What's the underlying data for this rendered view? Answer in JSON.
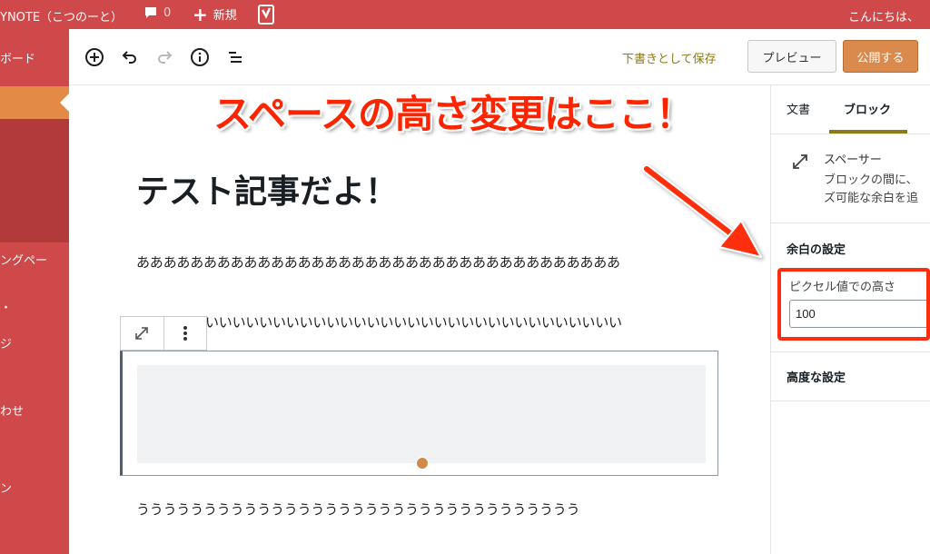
{
  "adminbar": {
    "site_title": "YNOTE（こつのーと）",
    "comment_count": "0",
    "new_label": "新規",
    "greeting": "こんにちは、"
  },
  "sidebar": {
    "items": [
      {
        "label": "ボード"
      },
      {
        "label": "ングペー"
      },
      {
        "label": "ジ"
      },
      {
        "label": "わせ"
      },
      {
        "label": "ン"
      }
    ]
  },
  "toolbar": {
    "save_draft": "下書きとして保存",
    "preview": "プレビュー",
    "publish": "公開する"
  },
  "annotation": {
    "text": "スペースの高さ変更はここ！",
    "color": "#ff2400"
  },
  "editor": {
    "post_title": "テスト記事だよ！",
    "para_a": "ああああああああああああああああああああああああああああああああああああ",
    "para_i": "いいいいいいいいいいいいいいいいいいいいいいいいいいいいいいい",
    "para_u": "ううううううううううううううううううううううううううううううううう"
  },
  "settings": {
    "tab_document": "文書",
    "tab_block": "ブロック",
    "block_name": "スペーサー",
    "block_description": "ブロックの間に、\nズ可能な余白を追",
    "spacing_panel_title": "余白の設定",
    "height_label": "ピクセル値での高さ",
    "height_value": "100",
    "advanced_title": "高度な設定"
  },
  "colors": {
    "adminbar": "#d0494a",
    "sidebar_active": "#e38a47",
    "publish": "#d98a4c",
    "accent": "#8a7a1a"
  }
}
